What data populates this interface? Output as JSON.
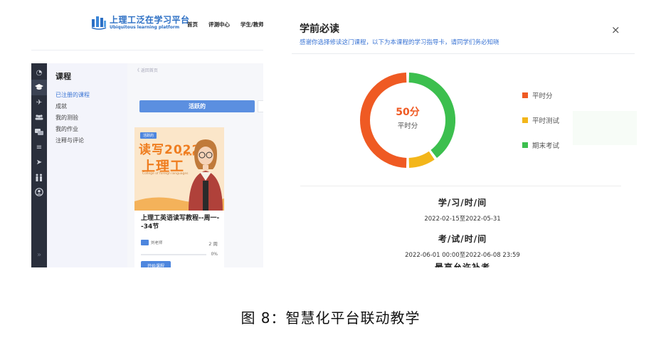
{
  "left": {
    "logo": {
      "name": "上理工泛在学习平台",
      "subtitle": "Ubiquitous learning platform",
      "color": "#2c6fc4"
    },
    "nav": [
      "首页",
      "评测中心",
      "学生/教师"
    ],
    "icon_bar": [
      "dashboard-icon",
      "graduation-cap-icon",
      "plane-icon",
      "people-icon",
      "chat-icon",
      "list-icon",
      "send-icon",
      "family-icon",
      "user-circle-icon",
      "double-chevron-icon"
    ],
    "sidebar": {
      "title": "课程",
      "items": [
        {
          "label": "已注册的课程",
          "active": true
        },
        {
          "label": "成就"
        },
        {
          "label": "我的测验"
        },
        {
          "label": "我的作业"
        },
        {
          "label": "注释与评论"
        }
      ]
    },
    "breadcrumb": "《 返回首页",
    "active_tab": "活跃的",
    "course_card": {
      "badge": "活跃的",
      "cover_title_a": "读写2022",
      "cover_title_b": "上理工",
      "cover_stars": "★★★★★",
      "cover_subtitle": "College of foreign languages",
      "title": "上理工英语读写教程--周一--34节",
      "teacher": "刘老师",
      "weeks": "2 周",
      "progress_label": "0%",
      "progress_value": 0,
      "start_button": "开始课程"
    }
  },
  "modal": {
    "title": "学前必读",
    "subtitle": "感谢你选择修读这门课程，以下为本课程的学习指导卡，请同学们务必知晓",
    "close": "×",
    "score_value": "50分",
    "score_caption": "平时分",
    "legend": [
      {
        "label": "平时分",
        "color": "#ef5a23"
      },
      {
        "label": "平时测试",
        "color": "#f3b61a"
      },
      {
        "label": "期末考试",
        "color": "#3cbf4e"
      }
    ],
    "sections": [
      {
        "heading": "学/习/时/间",
        "value": "2022-02-15至2022-05-31"
      },
      {
        "heading": "考/试/时/间",
        "value": "2022-06-01 00:00至2022-06-08 23:59"
      },
      {
        "heading": "最高允许补考"
      }
    ]
  },
  "chart_data": {
    "type": "pie",
    "categories": [
      "平时分",
      "平时测试",
      "期末考试"
    ],
    "values": [
      50,
      10,
      40
    ],
    "colors": [
      "#ef5a23",
      "#f3b61a",
      "#3cbf4e"
    ],
    "center_label": "50分",
    "center_caption": "平时分",
    "legend_position": "right"
  },
  "caption": "图 8：智慧化平台联动教学"
}
